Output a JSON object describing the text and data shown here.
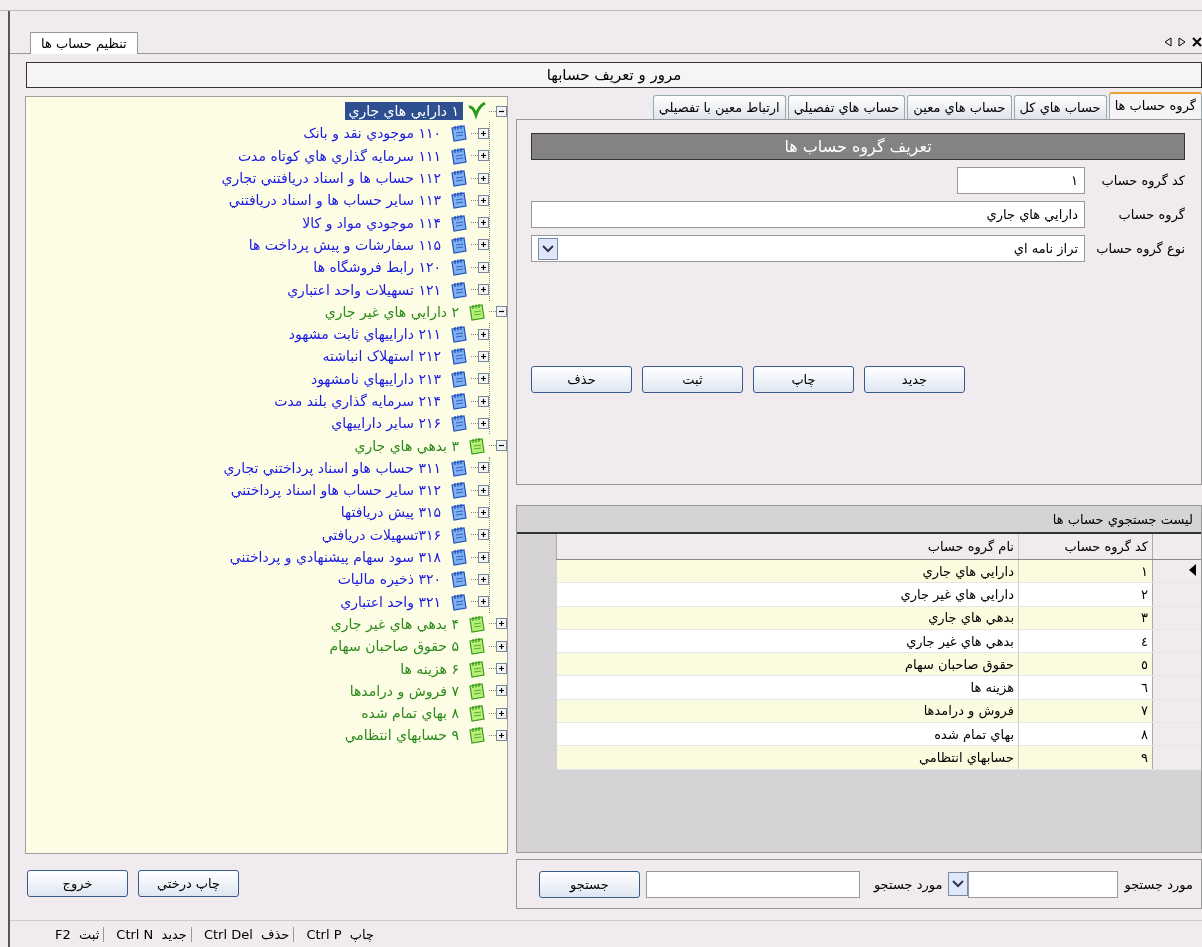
{
  "document_tab": {
    "label": "تنظيم حساب ها",
    "selected": true
  },
  "header": "مرور و تعريف حسابها",
  "tree": [
    {
      "label": "۱ دارايي هاي جاري",
      "selected": true,
      "expanded": true,
      "children": [
        {
          "label": "۱۱۰ موجودي نقد و بانک",
          "selected": false,
          "expanded": false
        },
        {
          "label": "۱۱۱ سرمايه گذاري هاي کوتاه مدت",
          "selected": false,
          "expanded": false
        },
        {
          "label": "۱۱۲ حساب ها و اسناد دريافتني تجاري",
          "selected": false,
          "expanded": false
        },
        {
          "label": "۱۱۳ ساير حساب ها و اسناد دريافتني",
          "selected": false,
          "expanded": false
        },
        {
          "label": "۱۱۴ موجودي مواد و کالا",
          "selected": false,
          "expanded": false
        },
        {
          "label": "۱۱۵ سفارشات و پيش پرداخت ها",
          "selected": false,
          "expanded": false
        },
        {
          "label": "۱۲۰ رابط فروشگاه ها",
          "selected": false,
          "expanded": false
        },
        {
          "label": "۱۲۱ تسهيلات واحد اعتباري",
          "selected": false,
          "expanded": false
        }
      ]
    },
    {
      "label": "۲ دارايي هاي غير جاري",
      "selected": false,
      "expanded": true,
      "children": [
        {
          "label": "۲۱۱ داراييهاي ثابت مشهود",
          "selected": false,
          "expanded": false
        },
        {
          "label": "۲۱۲ استهلاک انباشته",
          "selected": false,
          "expanded": false
        },
        {
          "label": "۲۱۳ داراييهاي نامشهود",
          "selected": false,
          "expanded": false
        },
        {
          "label": "۲۱۴ سرمايه گذاري بلند مدت",
          "selected": false,
          "expanded": false
        },
        {
          "label": "۲۱۶ ساير داراييهاي",
          "selected": false,
          "expanded": false
        }
      ]
    },
    {
      "label": "۳ بدهي هاي جاري",
      "selected": false,
      "expanded": true,
      "children": [
        {
          "label": "۳۱۱ حساب هاو اسناد پرداختني تجاري",
          "selected": false,
          "expanded": false
        },
        {
          "label": "۳۱۲ ساير حساب هاو اسناد پرداختني",
          "selected": false,
          "expanded": false
        },
        {
          "label": "۳۱۵ پيش دريافتها",
          "selected": false,
          "expanded": false
        },
        {
          "label": "۳۱۶تسهيلات دريافتي",
          "selected": false,
          "expanded": false
        },
        {
          "label": "۳۱۸ سود سهام پيشنهادي و پرداختني",
          "selected": false,
          "expanded": false
        },
        {
          "label": "۳۲۰ ذخيره ماليات",
          "selected": false,
          "expanded": false
        },
        {
          "label": "۳۲۱ واحد اعتباري",
          "selected": false,
          "expanded": false
        }
      ]
    },
    {
      "label": "۴ بدهي هاي غير جاري",
      "selected": false,
      "expanded": false
    },
    {
      "label": "۵ حقوق صاحبان سهام",
      "selected": false,
      "expanded": false
    },
    {
      "label": "۶ هزينه ها",
      "selected": false,
      "expanded": false
    },
    {
      "label": "۷ فروش و درامدها",
      "selected": false,
      "expanded": false
    },
    {
      "label": "۸ بهاي تمام شده",
      "selected": false,
      "expanded": false
    },
    {
      "label": "۹ حسابهاي انتظامي",
      "selected": false,
      "expanded": false
    }
  ],
  "tree_buttons": [
    "چاپ درختي",
    "خروج"
  ],
  "tabs": [
    {
      "label": "گروه حساب ها",
      "selected": true
    },
    {
      "label": "حساب هاي کل",
      "selected": false
    },
    {
      "label": "حساب هاي معين",
      "selected": false
    },
    {
      "label": "حساب هاي تفصيلي",
      "selected": false
    },
    {
      "label": "ارتباط معين با تفصيلي",
      "selected": false
    }
  ],
  "form": {
    "title": "تعريف گروه حساب ها",
    "fields": [
      {
        "kind": "short",
        "label": "کد گروه حساب",
        "value": "۱"
      },
      {
        "kind": "wide",
        "label": "گروه حساب",
        "value": "دارايي هاي جاري"
      },
      {
        "kind": "dropdown",
        "label": "نوع گروه حساب",
        "value": "تراز نامه اي"
      }
    ],
    "buttons": [
      "جديد",
      "چاپ",
      "ثبت",
      "حذف"
    ]
  },
  "grid": {
    "title": "ليست جستجوي حساب ها",
    "columns": [
      "کد گروه حساب",
      "نام گروه حساب"
    ],
    "rows": [
      {
        "code": "١",
        "name": "دارايي هاي جاري",
        "selected": true
      },
      {
        "code": "٢",
        "name": "دارايي هاي غير جاري",
        "selected": false
      },
      {
        "code": "٣",
        "name": "بدهي هاي جاري",
        "selected": false
      },
      {
        "code": "٤",
        "name": "بدهي هاي غير جاري",
        "selected": false
      },
      {
        "code": "٥",
        "name": "حقوق صاحبان سهام",
        "selected": false
      },
      {
        "code": "٦",
        "name": "هزينه ها",
        "selected": false
      },
      {
        "code": "٧",
        "name": "فروش و درامدها",
        "selected": false
      },
      {
        "code": "٨",
        "name": "بهاي تمام شده",
        "selected": false
      },
      {
        "code": "٩",
        "name": "حسابهاي انتظامي",
        "selected": false
      }
    ]
  },
  "search": {
    "field_label": "مورد جستجو",
    "text_label": "مورد جستجو",
    "button": "جستجو"
  },
  "status_bar": [
    {
      "label": "چاپ",
      "key": "Ctrl P"
    },
    {
      "label": "حذف",
      "key": "Ctrl Del"
    },
    {
      "label": "جديد",
      "key": "Ctrl N"
    },
    {
      "label": "ثبت",
      "key": "F2"
    }
  ]
}
